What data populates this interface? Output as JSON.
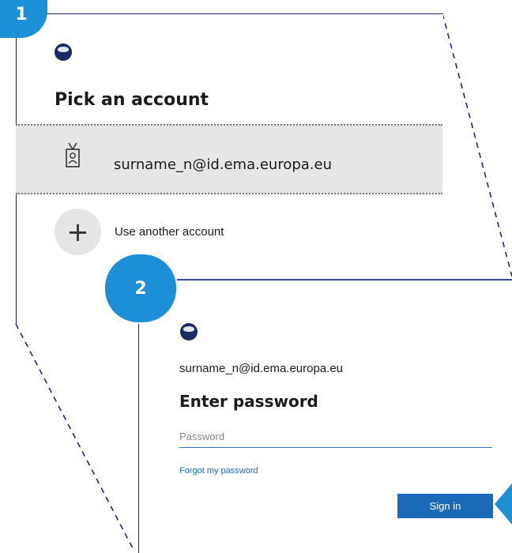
{
  "badges": {
    "step1": "1",
    "step2": "2"
  },
  "pick_account": {
    "title": "Pick an account",
    "account_email": "surname_n@id.ema.europa.eu",
    "use_another_label": "Use another account",
    "plus_symbol": "+",
    "icons": {
      "logo": "ema-logo-icon",
      "account": "id-badge-icon",
      "add": "plus-icon"
    }
  },
  "password_screen": {
    "email": "surname_n@id.ema.europa.eu",
    "title": "Enter password",
    "password_placeholder": "Password",
    "forgot_label": "Forgot my password",
    "signin_label": "Sign in",
    "icons": {
      "logo": "ema-logo-icon",
      "pointer": "callout-arrow-icon"
    }
  },
  "colors": {
    "badge": "#1c8fd6",
    "frame": "#1b2a7a",
    "signin_button": "#1a6ab8",
    "link": "#1f67c9",
    "selected_row": "#e6e6e6"
  }
}
